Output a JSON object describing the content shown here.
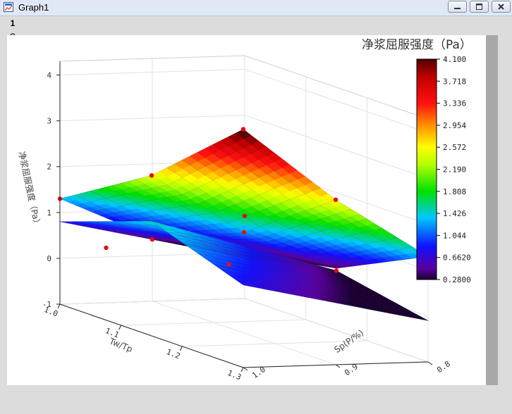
{
  "window": {
    "title": "Graph1",
    "layer_label": "1"
  },
  "icons": {
    "app": "graph-window-icon",
    "lock": "lock-icon",
    "minimize": "minimize-icon",
    "maximize": "maximize-icon",
    "close": "close-icon"
  },
  "colors": {
    "titlebar": "#dfe8f4",
    "page": "#ffffff",
    "background": "#dcdcdc",
    "marker": "#e01010"
  },
  "chart_data": {
    "type": "surface3d",
    "title": "净浆屈服强度（Pa）",
    "xlabel": "Tw/Tp",
    "ylabel": "Sp(P/%)",
    "zlabel": "净浆屈服强度（Pa）",
    "x_ticks": [
      "1.0",
      "1.1",
      "1.2",
      "1.3"
    ],
    "y_ticks": [
      "1.0",
      "0.9",
      "0.8"
    ],
    "z_ticks": [
      "-1",
      "0",
      "1",
      "2",
      "3",
      "4"
    ],
    "zlim": [
      -1,
      4.3
    ],
    "grid": true,
    "colorbar": {
      "ticks": [
        "4.100",
        "3.718",
        "3.336",
        "2.954",
        "2.572",
        "2.190",
        "1.808",
        "1.426",
        "1.044",
        "0.6620",
        "0.2800"
      ],
      "min": 0.28,
      "max": 4.1
    },
    "x_values": [
      1.0,
      1.15,
      1.3
    ],
    "y_values": [
      1.0,
      0.9,
      0.8
    ],
    "series": [
      {
        "values": [
          [
            1.3,
            2.5,
            4.2
          ],
          [
            0.4,
            1.2,
            2.6
          ],
          [
            0.0,
            0.35,
            1.3
          ]
        ]
      },
      {
        "values": [
          [
            0.8,
            1.5,
            0.8
          ],
          [
            0.35,
            0.9,
            0.35
          ],
          [
            -0.1,
            0.3,
            -0.1
          ]
        ]
      }
    ],
    "points": [
      {
        "x": 1.0,
        "y": 1.0,
        "z": 1.3
      },
      {
        "x": 1.15,
        "y": 1.0,
        "z": 2.5
      },
      {
        "x": 1.3,
        "y": 1.0,
        "z": 4.2
      },
      {
        "x": 1.3,
        "y": 0.9,
        "z": 2.6
      },
      {
        "x": 1.3,
        "y": 0.8,
        "z": 1.3
      },
      {
        "x": 1.15,
        "y": 0.9,
        "z": 1.2
      },
      {
        "x": 1.0,
        "y": 0.8,
        "z": 0.8
      },
      {
        "x": 1.0,
        "y": 0.9,
        "z": 0.35
      },
      {
        "x": 1.0,
        "y": 0.95,
        "z": 0.2
      },
      {
        "x": 1.15,
        "y": 0.8,
        "z": 0.3
      },
      {
        "x": 1.05,
        "y": 0.85,
        "z": 0.0
      }
    ]
  }
}
